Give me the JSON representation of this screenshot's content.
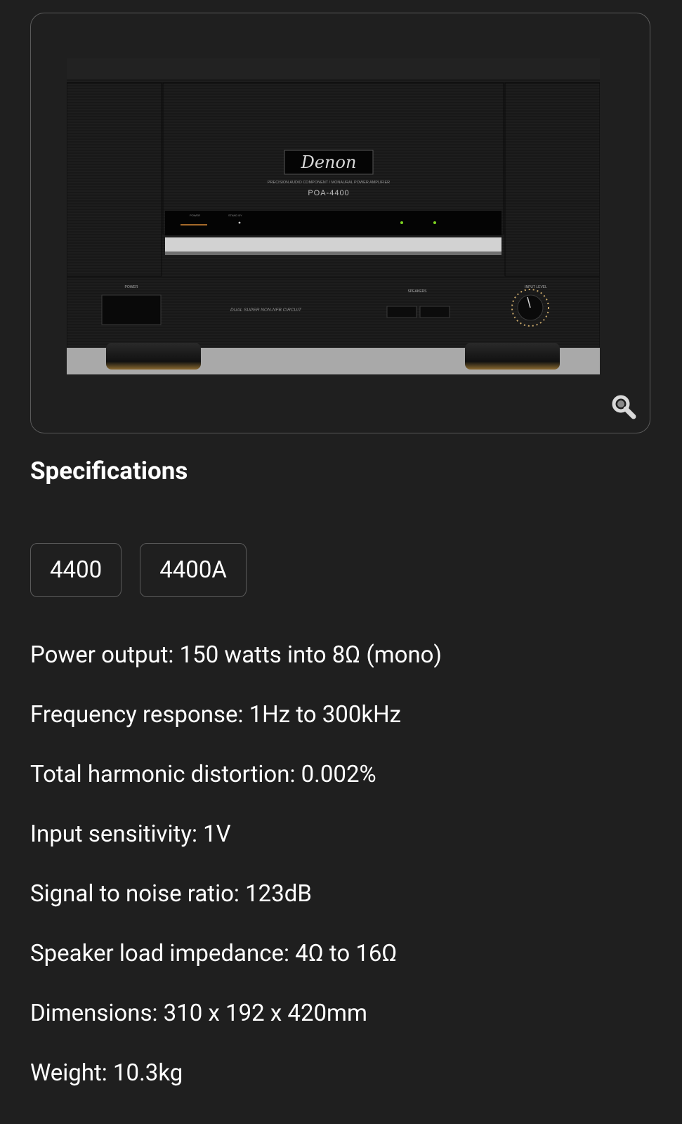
{
  "product_image": {
    "brand": "Denon",
    "model": "POA-4400",
    "subtitle": "PRECISION AUDIO COMPONENT / MONAURAL POWER AMPLIFIER",
    "power_label": "POWER",
    "standby_label": "STAND BY",
    "speakers_label": "SPEAKERS",
    "input_level_label": "INPUT LEVEL",
    "circuit_label": "DUAL SUPER NON-NFB CIRCUIT",
    "zoom_icon": "magnifier-icon"
  },
  "section": {
    "title": "Specifications"
  },
  "variant_tabs": [
    {
      "label": "4400"
    },
    {
      "label": "4400A"
    }
  ],
  "specs": [
    {
      "text": "Power output: 150 watts into 8Ω (mono)"
    },
    {
      "text": "Frequency response: 1Hz to 300kHz"
    },
    {
      "text": "Total harmonic distortion: 0.002%"
    },
    {
      "text": "Input sensitivity: 1V"
    },
    {
      "text": "Signal to noise ratio: 123dB"
    },
    {
      "text": "Speaker load impedance: 4Ω to 16Ω"
    },
    {
      "text": "Dimensions: 310 x 192 x 420mm"
    },
    {
      "text": "Weight: 10.3kg"
    }
  ],
  "colors": {
    "background": "#1f1f1f",
    "border": "#5a5a5a",
    "text": "#ffffff",
    "led_green": "#7dd321"
  }
}
